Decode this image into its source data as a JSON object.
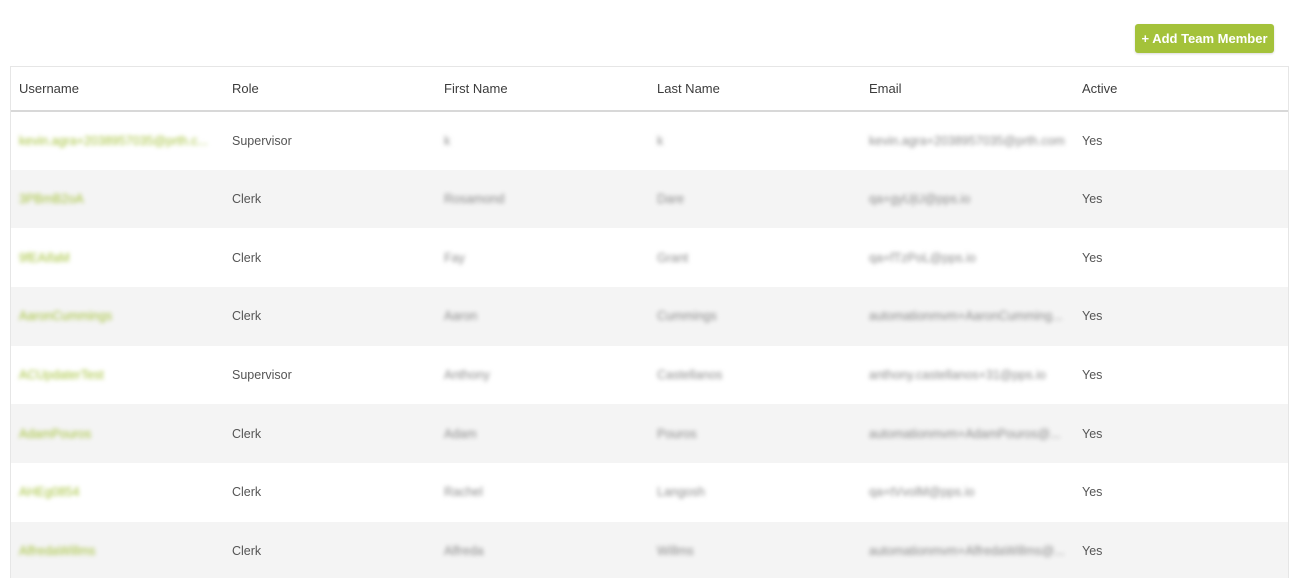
{
  "toolbar": {
    "add_label": "+ Add Team Member"
  },
  "table": {
    "headers": {
      "username": "Username",
      "role": "Role",
      "first_name": "First Name",
      "last_name": "Last Name",
      "email": "Email",
      "active": "Active"
    },
    "rows": [
      {
        "username": "kevin.agra+2038957035@prth.c...",
        "role": "Supervisor",
        "first_name": "k",
        "last_name": "k",
        "email": "kevin.agra+2038957035@prth.com",
        "active": "Yes"
      },
      {
        "username": "3PBmB2oA",
        "role": "Clerk",
        "first_name": "Rosamond",
        "last_name": "Dare",
        "email": "qa+gyUjU@pps.io",
        "active": "Yes"
      },
      {
        "username": "9fEAifaM",
        "role": "Clerk",
        "first_name": "Fay",
        "last_name": "Grant",
        "email": "qa+fTzPoL@pps.io",
        "active": "Yes"
      },
      {
        "username": "AaronCummings",
        "role": "Clerk",
        "first_name": "Aaron",
        "last_name": "Cummings",
        "email": "automationmvm+AaronCumming...",
        "active": "Yes"
      },
      {
        "username": "ACUpdaterTest",
        "role": "Supervisor",
        "first_name": "Anthony",
        "last_name": "Castellanos",
        "email": "anthony.castellanos+31@pps.io",
        "active": "Yes"
      },
      {
        "username": "AdamPouros",
        "role": "Clerk",
        "first_name": "Adam",
        "last_name": "Pouros",
        "email": "automationmvm+AdamPouros@...",
        "active": "Yes"
      },
      {
        "username": "AHEg0854",
        "role": "Clerk",
        "first_name": "Rachel",
        "last_name": "Langosh",
        "email": "qa+tVvolM@pps.io",
        "active": "Yes"
      },
      {
        "username": "AlfredaWillms",
        "role": "Clerk",
        "first_name": "Alfreda",
        "last_name": "Willms",
        "email": "automationmvm+AlfredaWillms@...",
        "active": "Yes"
      }
    ]
  },
  "colors": {
    "accent": "#a4c23a",
    "stripe": "#f4f4f4"
  }
}
